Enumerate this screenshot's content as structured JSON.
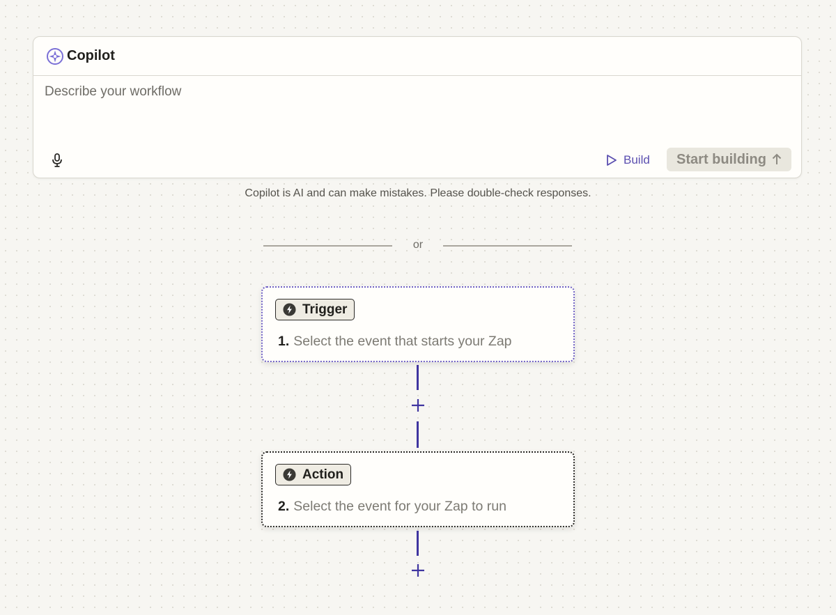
{
  "copilot": {
    "title": "Copilot",
    "input_placeholder": "Describe your workflow",
    "input_value": "",
    "build_label": "Build",
    "start_label": "Start building",
    "disclaimer": "Copilot is AI and can make mistakes. Please double-check responses."
  },
  "divider": {
    "label": "or"
  },
  "steps": [
    {
      "badge": "Trigger",
      "number": "1.",
      "description": "Select the event that starts your Zap",
      "icon": "bolt-icon",
      "border_color": "#6f60c4"
    },
    {
      "badge": "Action",
      "number": "2.",
      "description": "Select the event for your Zap to run",
      "icon": "bolt-icon",
      "border_color": "#2a2926"
    }
  ],
  "colors": {
    "accent": "#5b4fb0",
    "connector": "#3f35a0",
    "background": "#f7f6f2"
  },
  "icons": {
    "copilot_logo": "copilot-sparkle-icon",
    "mic": "microphone-icon",
    "build": "play-outline-icon",
    "start": "arrow-up-icon",
    "add": "plus-icon"
  }
}
